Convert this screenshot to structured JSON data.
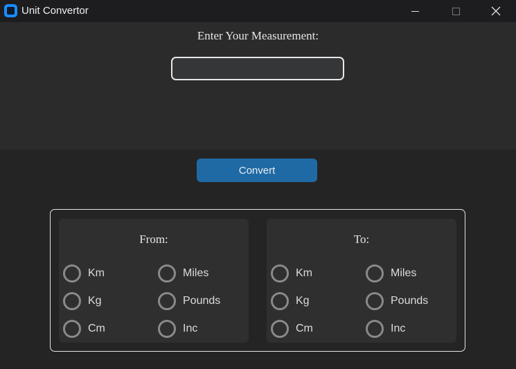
{
  "window": {
    "title": "Unit Convertor"
  },
  "prompt": {
    "text": "Enter Your Measurement:"
  },
  "input": {
    "value": "",
    "placeholder": ""
  },
  "convert": {
    "label": "Convert"
  },
  "from": {
    "title": "From:",
    "options": [
      "Km",
      "Miles",
      "Kg",
      "Pounds",
      "Cm",
      "Inc"
    ]
  },
  "to": {
    "title": "To:",
    "options": [
      "Km",
      "Miles",
      "Kg",
      "Pounds",
      "Cm",
      "Inc"
    ]
  },
  "colors": {
    "accent": "#1f6aa5",
    "app_icon": "#1a8cff",
    "background": "#242424",
    "panel": "#2b2b2b"
  },
  "icons": {
    "app": "app-icon",
    "minimize": "minimize-icon",
    "maximize": "maximize-icon",
    "close": "close-icon"
  }
}
